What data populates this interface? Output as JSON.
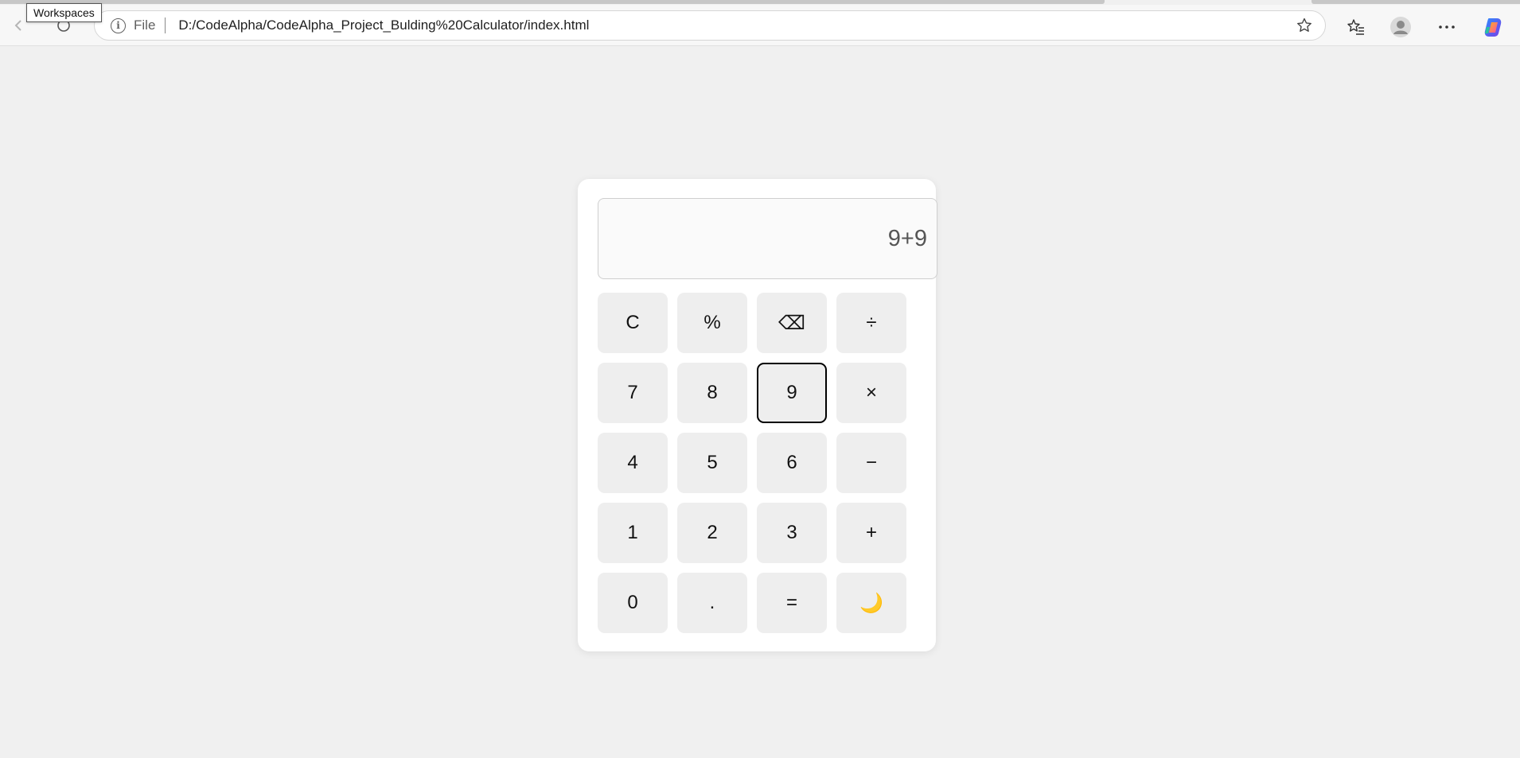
{
  "browser": {
    "tooltip": "Workspaces",
    "address_scheme": "File",
    "address_url": "D:/CodeAlpha/CodeAlpha_Project_Bulding%20Calculator/index.html",
    "icons": {
      "back": "back-arrow-icon",
      "refresh": "refresh-icon",
      "info": "info-icon",
      "favorite": "star-icon",
      "favorites": "favorites-list-icon",
      "profile": "profile-avatar-icon",
      "more": "more-menu-icon",
      "copilot": "copilot-icon"
    }
  },
  "calculator": {
    "display": "9+9",
    "keys": [
      {
        "label": "C",
        "name": "clear"
      },
      {
        "label": "%",
        "name": "percent"
      },
      {
        "label": "⌫",
        "name": "backspace"
      },
      {
        "label": "÷",
        "name": "divide"
      },
      {
        "label": "7",
        "name": "digit-7"
      },
      {
        "label": "8",
        "name": "digit-8"
      },
      {
        "label": "9",
        "name": "digit-9",
        "focused": true
      },
      {
        "label": "×",
        "name": "multiply"
      },
      {
        "label": "4",
        "name": "digit-4"
      },
      {
        "label": "5",
        "name": "digit-5"
      },
      {
        "label": "6",
        "name": "digit-6"
      },
      {
        "label": "−",
        "name": "subtract"
      },
      {
        "label": "1",
        "name": "digit-1"
      },
      {
        "label": "2",
        "name": "digit-2"
      },
      {
        "label": "3",
        "name": "digit-3"
      },
      {
        "label": "+",
        "name": "add"
      },
      {
        "label": "0",
        "name": "digit-0"
      },
      {
        "label": ".",
        "name": "decimal"
      },
      {
        "label": "=",
        "name": "equals"
      },
      {
        "label": "🌙",
        "name": "theme-toggle",
        "icon": "moon-icon"
      }
    ]
  },
  "colors": {
    "page_background": "#f0f0f0",
    "card_background": "#ffffff",
    "key_background": "#eeeeee",
    "focus_border": "#000000"
  }
}
